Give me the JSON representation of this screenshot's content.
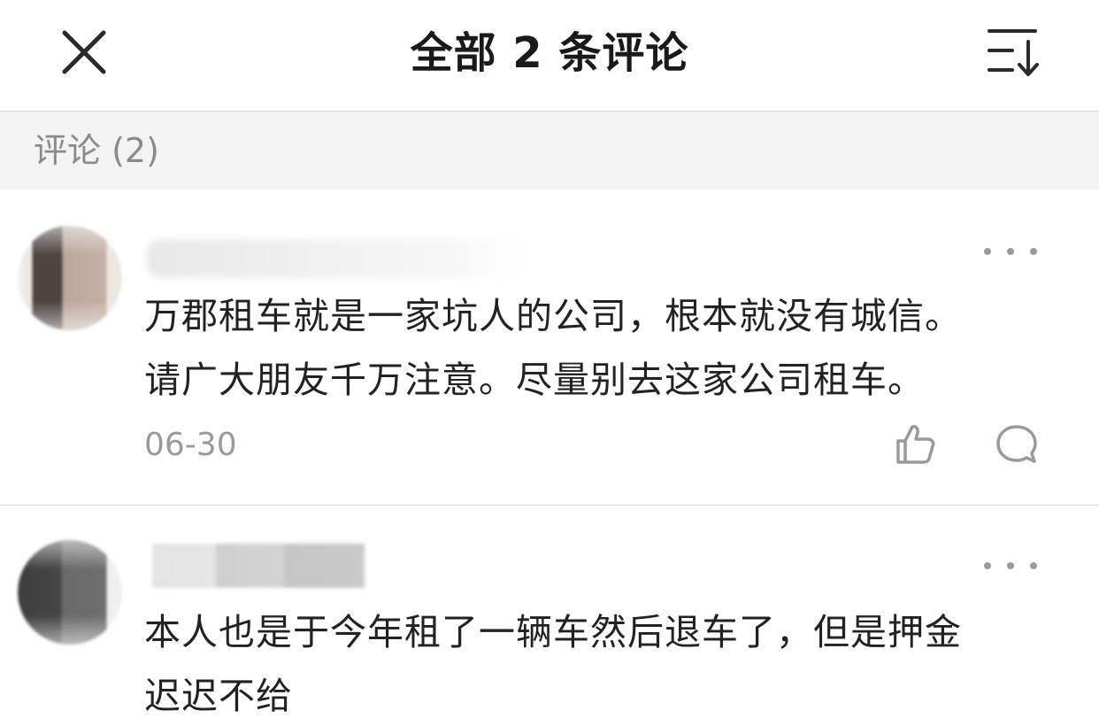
{
  "header": {
    "title": "全部 2 条评论",
    "close_icon": "close-icon",
    "sort_icon": "sort-icon"
  },
  "section": {
    "label": "评论 (2)"
  },
  "comments": [
    {
      "avatar": "blurred-avatar",
      "username": "",
      "text_lines": [
        "万郡租车就是一家坑人的公司，根本就没有城信。",
        "请广大朋友千万注意。尽量别去这家公司租车。"
      ],
      "date": "06-30",
      "more_icon": "more-icon",
      "like_icon": "thumbs-up-icon",
      "reply_icon": "comment-bubble-icon"
    },
    {
      "avatar": "blurred-avatar",
      "username": "",
      "text_lines": [
        "本人也是于今年租了一辆车然后退车了，但是押金",
        "迟迟不给"
      ],
      "more_icon": "more-icon"
    }
  ],
  "colors": {
    "text_primary": "#222222",
    "text_secondary": "#9a9a9a",
    "section_bg": "#f3f3f3",
    "divider": "#dcdcdc",
    "icon": "#9a9a9a"
  }
}
